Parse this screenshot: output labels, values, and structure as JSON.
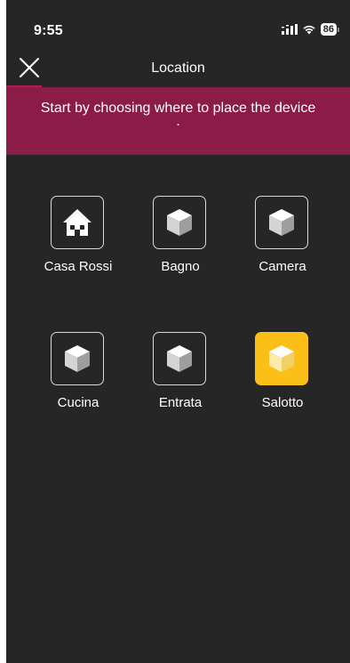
{
  "status_bar": {
    "time": "9:55",
    "battery": "86",
    "icons": [
      "signal-icon",
      "wifi-icon",
      "battery-icon"
    ]
  },
  "header": {
    "title": "Location",
    "close_icon": "close-icon"
  },
  "banner": {
    "text": "Start by choosing where to place the device",
    "dot": "."
  },
  "rooms": [
    {
      "label": "Casa Rossi",
      "icon": "house-icon",
      "selected": false
    },
    {
      "label": "Bagno",
      "icon": "cube-icon",
      "selected": false
    },
    {
      "label": "Camera",
      "icon": "cube-icon",
      "selected": false
    },
    {
      "label": "Cucina",
      "icon": "cube-icon",
      "selected": false
    },
    {
      "label": "Entrata",
      "icon": "cube-icon",
      "selected": false
    },
    {
      "label": "Salotto",
      "icon": "cube-icon",
      "selected": true
    }
  ],
  "colors": {
    "background": "#262626",
    "banner": "#8b1c48",
    "accent_underline": "#b31c4e",
    "selected": "#fcbf17"
  }
}
